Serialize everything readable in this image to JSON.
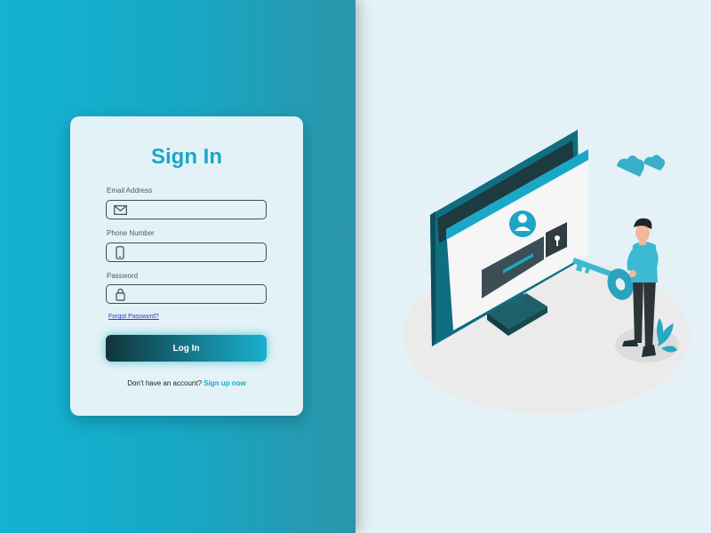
{
  "colors": {
    "accent": "#19a8c8",
    "left_panel": "#14afcf",
    "right_panel": "#e4f2f7",
    "card": "#e3f2f6",
    "link": "#2639c8"
  },
  "form": {
    "title": "Sign In",
    "email": {
      "label": "Email Address",
      "value": "",
      "placeholder": "",
      "icon": "envelope-icon"
    },
    "phone": {
      "label": "Phone Number",
      "value": "",
      "placeholder": "",
      "icon": "phone-icon"
    },
    "password": {
      "label": "Password",
      "value": "",
      "placeholder": "",
      "icon": "lock-icon"
    },
    "forgot_label": "Forgot Password?",
    "login_label": "Log In",
    "signup_prompt": "Don't have an account?",
    "signup_link": "Sign up now"
  },
  "illustration": {
    "subject": "person-with-key-unlocking-computer",
    "icons": [
      "monitor-icon",
      "user-avatar-icon",
      "keyhole-icon",
      "key-icon",
      "person-icon",
      "cloud-icon",
      "plant-icon"
    ]
  }
}
